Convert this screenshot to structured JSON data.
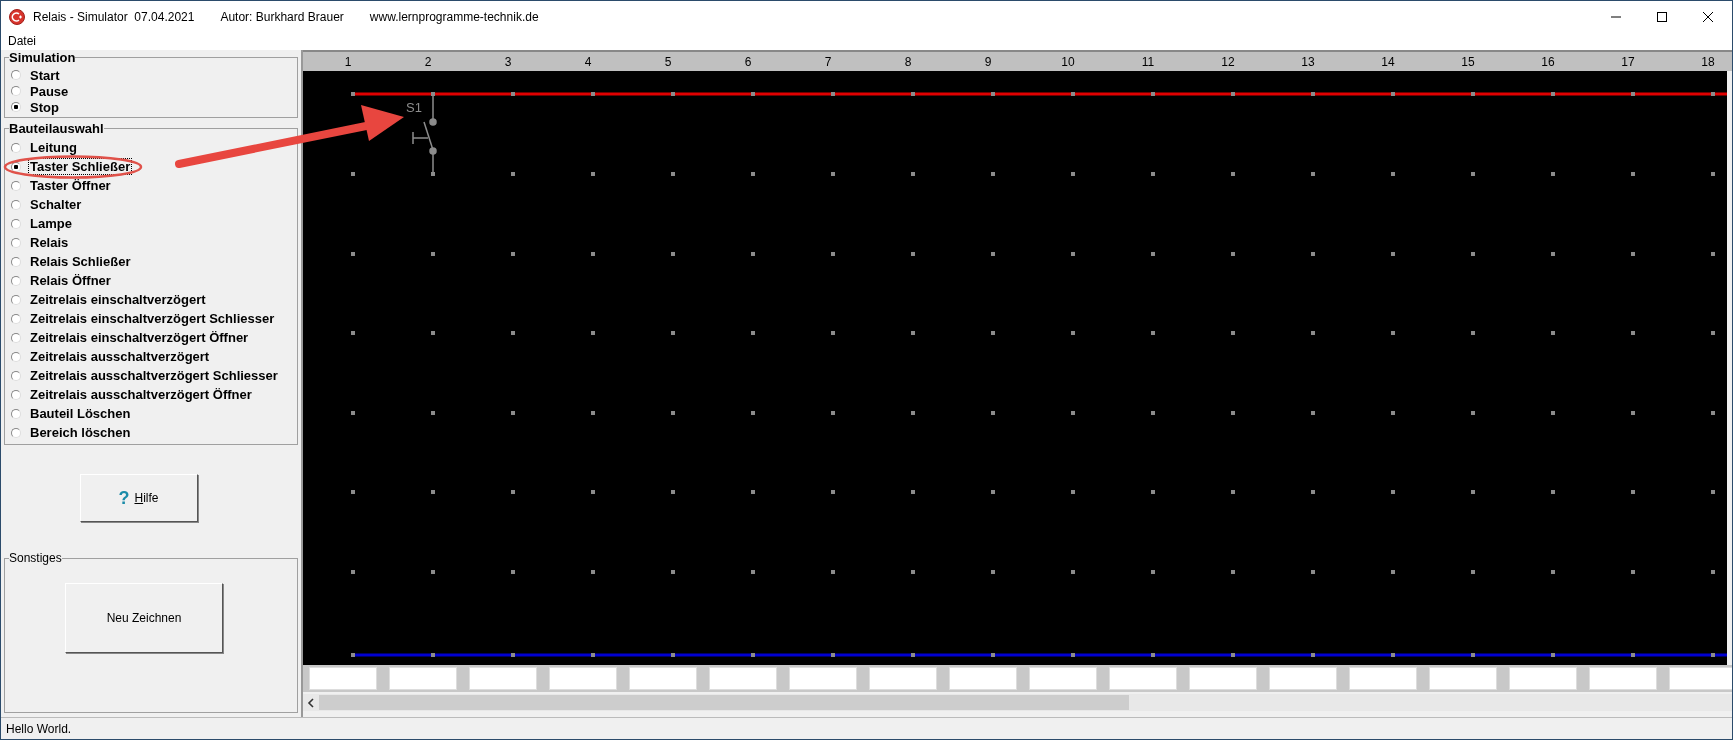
{
  "window": {
    "title": "Relais - Simulator  07.04.2021",
    "author": "Autor: Burkhard Brauer",
    "website": "www.lernprogramme-technik.de"
  },
  "menu": [
    "Datei"
  ],
  "simulation": {
    "title": "Simulation",
    "options": [
      {
        "label": "Start",
        "selected": false
      },
      {
        "label": "Pause",
        "selected": false
      },
      {
        "label": "Stop",
        "selected": true
      }
    ]
  },
  "components": {
    "title": "Bauteilauswahl",
    "options": [
      {
        "label": "Leitung",
        "selected": false
      },
      {
        "label": "Taster Schließer",
        "selected": true
      },
      {
        "label": "Taster Öffner",
        "selected": false
      },
      {
        "label": "Schalter",
        "selected": false
      },
      {
        "label": "Lampe",
        "selected": false
      },
      {
        "label": "Relais",
        "selected": false
      },
      {
        "label": "Relais Schließer",
        "selected": false
      },
      {
        "label": "Relais Öffner",
        "selected": false
      },
      {
        "label": "Zeitrelais einschaltverzögert",
        "selected": false
      },
      {
        "label": "Zeitrelais einschaltverzögert Schliesser",
        "selected": false
      },
      {
        "label": "Zeitrelais einschaltverzögert Öffner",
        "selected": false
      },
      {
        "label": "Zeitrelais ausschaltverzögert",
        "selected": false
      },
      {
        "label": "Zeitrelais ausschaltverzögert Schliesser",
        "selected": false
      },
      {
        "label": "Zeitrelais ausschaltverzögert Öffner",
        "selected": false
      },
      {
        "label": "Bauteil Löschen",
        "selected": false
      },
      {
        "label": "Bereich löschen",
        "selected": false
      }
    ]
  },
  "help_button": "Hilfe",
  "help_icon": "?",
  "other": {
    "title": "Sonstiges",
    "button": "Neu Zeichnen"
  },
  "columns": [
    "1",
    "2",
    "3",
    "4",
    "5",
    "6",
    "7",
    "8",
    "9",
    "10",
    "11",
    "12",
    "13",
    "14",
    "15",
    "16",
    "17",
    "18"
  ],
  "rails": [
    {
      "kind": "top",
      "color": "#e00000"
    },
    {
      "kind": "bottom",
      "color": "#0000d0"
    }
  ],
  "placed": [
    {
      "kind": "pushbutton-no",
      "label": "S1"
    }
  ],
  "status_bar": "Hello World."
}
